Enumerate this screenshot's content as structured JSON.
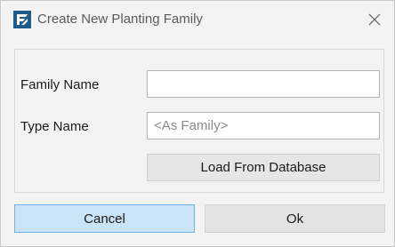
{
  "window": {
    "title": "Create New Planting Family",
    "icon": "app-logo-icon",
    "close_icon": "close-icon"
  },
  "form": {
    "family_name": {
      "label": "Family Name",
      "value": "",
      "placeholder": ""
    },
    "type_name": {
      "label": "Type Name",
      "value": "",
      "placeholder": "<As Family>"
    },
    "load_button_label": "Load From Database"
  },
  "buttons": {
    "cancel_label": "Cancel",
    "ok_label": "Ok"
  },
  "colors": {
    "app_icon": "#1d5c8c",
    "cancel_bg": "#c9e3f7",
    "cancel_border": "#6fb2e6",
    "ok_bg": "#e3e3e3"
  }
}
